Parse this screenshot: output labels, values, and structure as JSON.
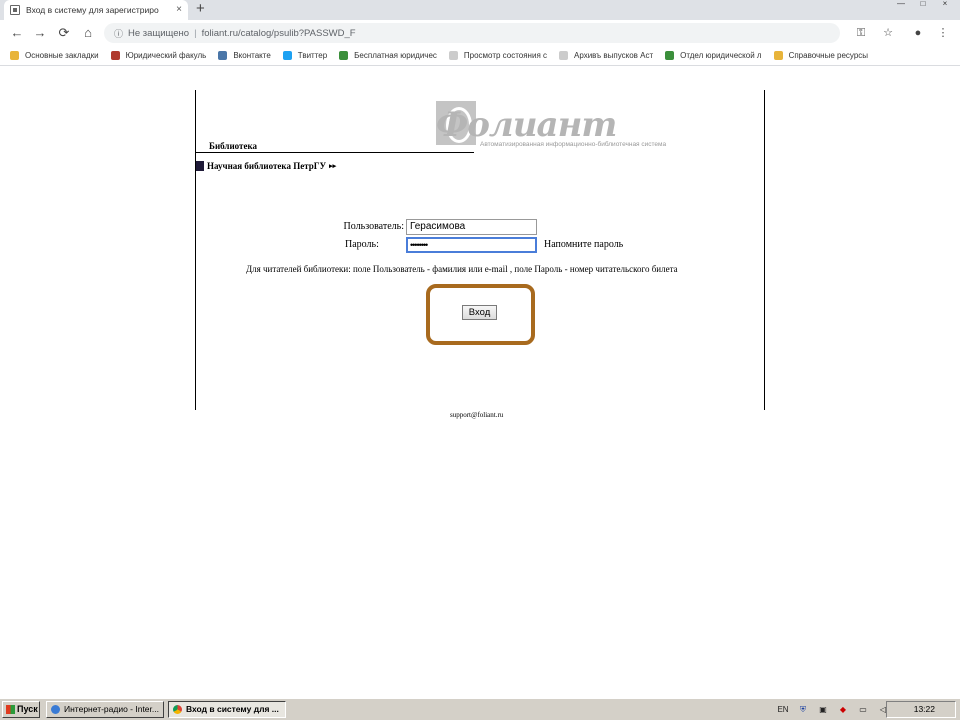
{
  "browser": {
    "tab_title": "Вход в систему для зарегистриро",
    "tab_close": "×",
    "new_tab": "+",
    "window_controls": [
      "—",
      "□",
      "×"
    ],
    "nav": {
      "back": "←",
      "forward": "→",
      "reload": "⟳",
      "home": "⌂"
    },
    "address": {
      "security_label": "Не защищено",
      "separator": "|",
      "url": "foliant.ru/catalog/psulib?PASSWD_F"
    },
    "toolbar_icons": {
      "key": "⚿",
      "star": "☆",
      "account": "●",
      "menu": "⋮"
    },
    "bookmarks": [
      {
        "label": "Основные закладки",
        "color": "#e8b43a"
      },
      {
        "label": "Юридический факуль",
        "color": "#b03a2e"
      },
      {
        "label": "Вконтакте",
        "color": "#4a76a8"
      },
      {
        "label": "Твиттер",
        "color": "#1da1f2"
      },
      {
        "label": "Бесплатная юридичес",
        "color": "#3b8f3b"
      },
      {
        "label": "Просмотр состояния с",
        "color": "#cccccc"
      },
      {
        "label": "Архивъ выпусков Аст",
        "color": "#cccccc"
      },
      {
        "label": "Отдел юридической л",
        "color": "#3b8f3b"
      },
      {
        "label": "Справочные ресурсы",
        "color": "#e8b43a"
      }
    ]
  },
  "page": {
    "logo_word": "Фолиант",
    "logo_subtitle": "Автоматизированная информационно-библиотечная система",
    "section_label": "Библиотека",
    "library_name": "Научная библиотека ПетрГУ",
    "library_arrows": "▸▸",
    "form": {
      "user_label": "Пользователь:",
      "user_value": "Герасимова",
      "pass_label": "Пароль:",
      "pass_value": "••••••••",
      "remind_link": "Напомните пароль"
    },
    "hint": "Для читателей библиотеки: поле Пользователь - фамилия или e-mail , поле Пароль - номер читательского билета",
    "login_button": "Вход",
    "support_email": "support@foliant.ru"
  },
  "taskbar": {
    "start_label": "Пуск",
    "tasks": [
      {
        "label": "Интернет-радио - Inter...",
        "active": false
      },
      {
        "label": "Вход в систему для ...",
        "active": true
      }
    ],
    "lang": "EN",
    "clock": "13:22"
  }
}
